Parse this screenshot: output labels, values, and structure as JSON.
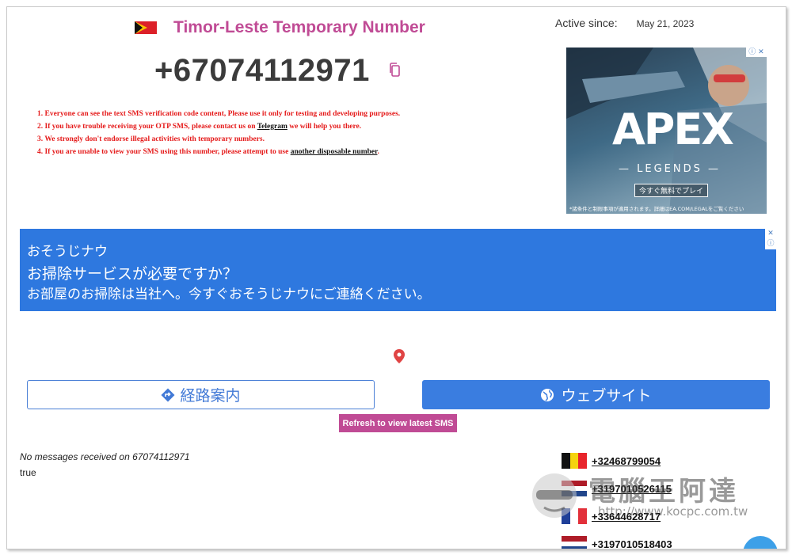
{
  "header": {
    "title": "Timor-Leste Temporary Number",
    "active_label": "Active since:",
    "active_date": "May 21, 2023",
    "phone_number": "+67074112971"
  },
  "rules": [
    {
      "text": "1. Everyone can see the text SMS verification code content, Please use it only for testing and developing purposes.",
      "link": "",
      "after": ""
    },
    {
      "text": "2. If you have trouble receiving your OTP SMS, please contact us on ",
      "link": "Telegram",
      "after": " we will help you there."
    },
    {
      "text": "3. We strongly don't endorse illegal activities with temporary numbers.",
      "link": "",
      "after": ""
    },
    {
      "text": "4. If you are unable to view your SMS using this number, please attempt to use ",
      "link": "another disposable number",
      "after": "."
    }
  ],
  "ad_apex": {
    "title": "APEX",
    "subtitle": "— LEGENDS —",
    "cta": "今すぐ無料でプレイ",
    "fine_print": "*諸条件と制限事項が適用されます。詳細はEA.COM/LEGALをご覧ください"
  },
  "ad_blue": {
    "advertiser": "おそうじナウ",
    "headline": "お掃除サービスが必要ですか？",
    "description": "お部屋のお掃除は当社へ。今すぐおそうじナウにご連絡ください。"
  },
  "ad_buttons": {
    "route_label": "経路案内",
    "website_label": "ウェブサイト"
  },
  "refresh_label": "Refresh to view latest SMS",
  "messages": {
    "empty_text": "No messages received on 67074112971",
    "status": "true"
  },
  "other_numbers": [
    {
      "number": "+32468799054",
      "flag": "belgium",
      "colors": [
        "#111111",
        "#f5d30f",
        "#e8242b"
      ],
      "layout": "vertical"
    },
    {
      "number": "+3197010526115",
      "flag": "netherlands",
      "colors": [
        "#ae1c28",
        "#ffffff",
        "#21468b"
      ],
      "layout": "horizontal"
    },
    {
      "number": "+33644628717",
      "flag": "france",
      "colors": [
        "#1f3f99",
        "#ffffff",
        "#e2303a"
      ],
      "layout": "vertical"
    },
    {
      "number": "+3197010518403",
      "flag": "netherlands",
      "colors": [
        "#ae1c28",
        "#ffffff",
        "#21468b"
      ],
      "layout": "horizontal"
    }
  ],
  "watermark": {
    "text": "電腦王阿達",
    "url": "http://www.kocpc.com.tw"
  },
  "colors": {
    "brand_pink": "#c04b95",
    "warning_red": "#e51b1b",
    "ad_blue": "#2e78df"
  }
}
